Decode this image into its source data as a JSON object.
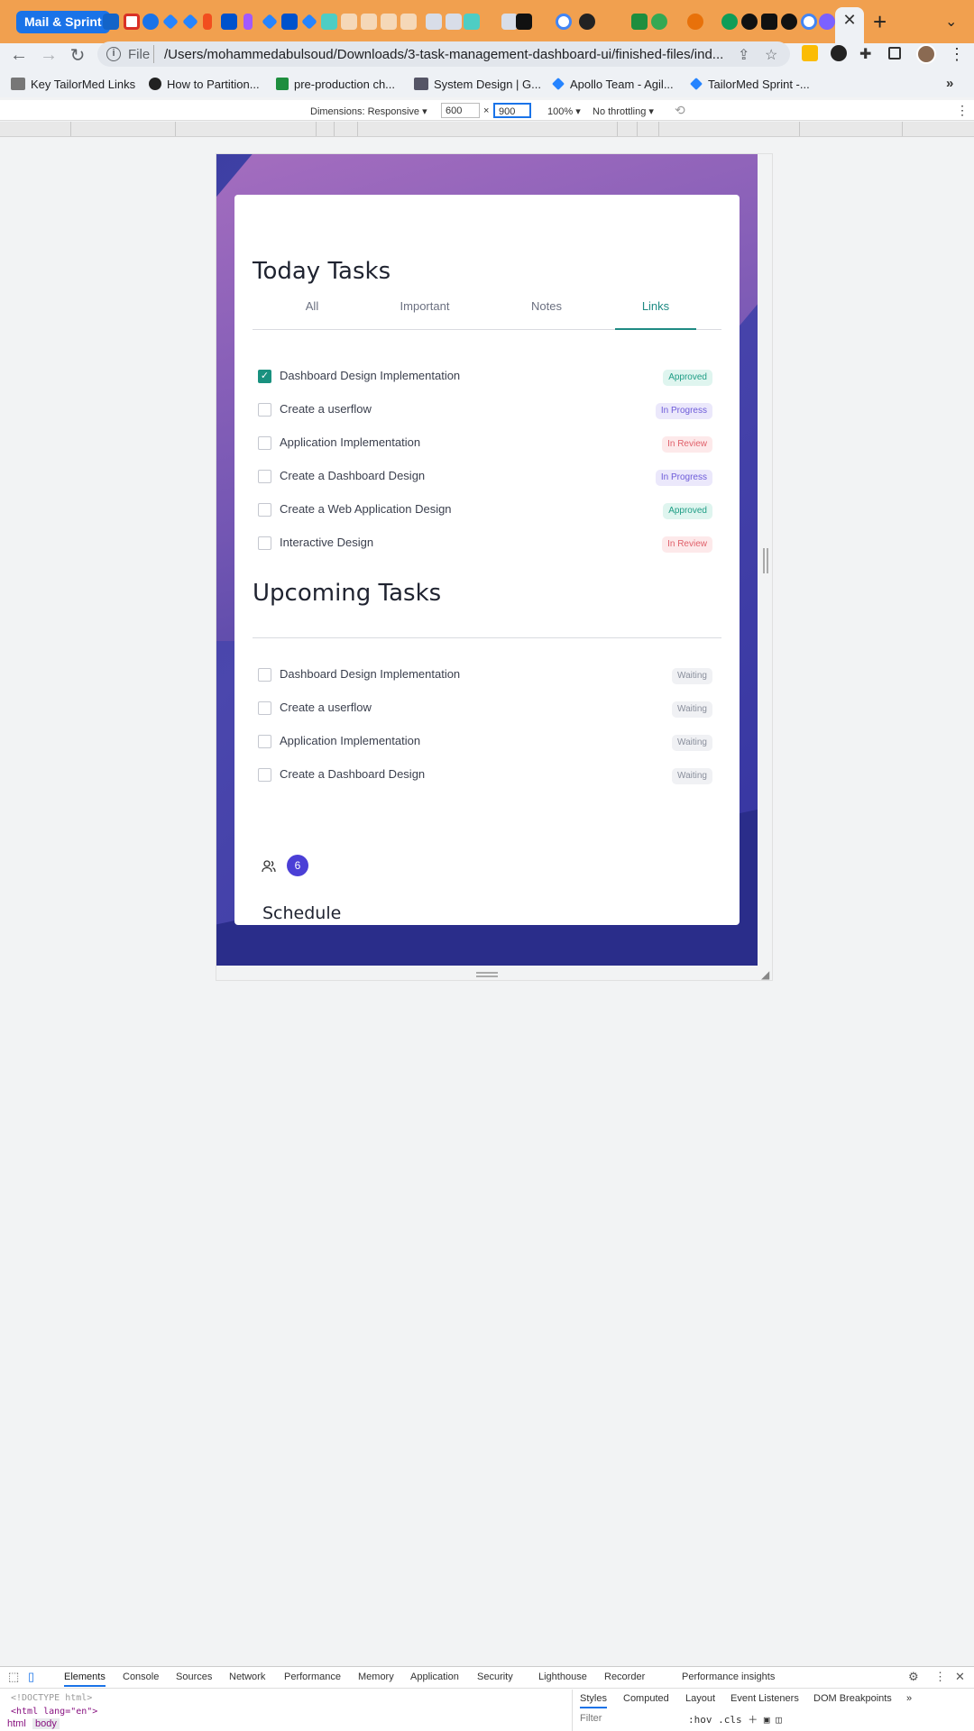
{
  "browser": {
    "tab_group_label": "Mail & Sprint",
    "url_scheme": "File",
    "url": "/Users/mohammedabulsoud/Downloads/3-task-management-dashboard-ui/finished-files/ind...",
    "bookmarks": [
      "Key TailorMed Links",
      "How to Partition...",
      "pre-production ch...",
      "System Design | G...",
      "Apollo Team - Agil...",
      "TailorMed Sprint -..."
    ],
    "bookmarks_more": "»"
  },
  "device_toolbar": {
    "dimensions_label": "Dimensions: Responsive",
    "width": "600",
    "times": "×",
    "height": "900",
    "zoom": "100%",
    "throttling": "No throttling"
  },
  "today": {
    "title": "Today Tasks",
    "tabs": [
      "All",
      "Important",
      "Notes",
      "Links"
    ],
    "active_tab": "Links",
    "tasks": [
      {
        "label": "Dashboard Design Implementation",
        "status": "Approved",
        "checked": true
      },
      {
        "label": "Create a userflow",
        "status": "In Progress",
        "checked": false
      },
      {
        "label": "Application Implementation",
        "status": "In Review",
        "checked": false
      },
      {
        "label": "Create a Dashboard Design",
        "status": "In Progress",
        "checked": false
      },
      {
        "label": "Create a Web Application Design",
        "status": "Approved",
        "checked": false
      },
      {
        "label": "Interactive Design",
        "status": "In Review",
        "checked": false
      }
    ]
  },
  "upcoming": {
    "title": "Upcoming Tasks",
    "tasks": [
      {
        "label": "Dashboard Design Implementation",
        "status": "Waiting"
      },
      {
        "label": "Create a userflow",
        "status": "Waiting"
      },
      {
        "label": "Application Implementation",
        "status": "Waiting"
      },
      {
        "label": "Create a Dashboard Design",
        "status": "Waiting"
      }
    ]
  },
  "team": {
    "count": "6"
  },
  "schedule": {
    "title": "Schedule"
  },
  "devtools": {
    "tabs": [
      "Elements",
      "Console",
      "Sources",
      "Network",
      "Performance",
      "Memory",
      "Application",
      "Security",
      "Lighthouse",
      "Recorder",
      "Performance insights"
    ],
    "code_lines": [
      "<!DOCTYPE html>",
      "<html lang=\"en\">"
    ],
    "breadcrumbs": [
      "html",
      "body"
    ],
    "styles_tabs": [
      "Styles",
      "Computed",
      "Layout",
      "Event Listeners",
      "DOM Breakpoints"
    ],
    "filter_placeholder": "Filter",
    "filter_tools": ":hov .cls"
  },
  "colors": {
    "accent": "#1e8a83",
    "tab_strip": "#f1a04f",
    "approved": "#1e9d85",
    "in_progress": "#6d5bd9",
    "in_review": "#e0606a",
    "waiting": "#8a8f9c"
  }
}
